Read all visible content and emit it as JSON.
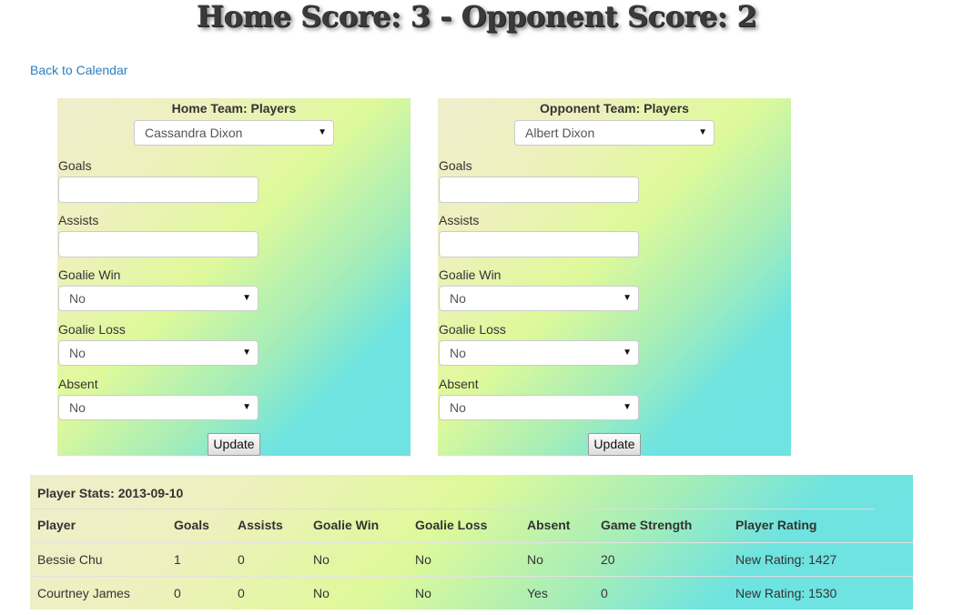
{
  "header": {
    "title": "Home Score: 3 - Opponent Score: 2"
  },
  "nav": {
    "back_link": "Back to Calendar"
  },
  "home": {
    "title": "Home Team: Players",
    "selected_player": "Cassandra Dixon",
    "goals_label": "Goals",
    "goals_value": "",
    "assists_label": "Assists",
    "assists_value": "",
    "goalie_win_label": "Goalie Win",
    "goalie_win_value": "No",
    "goalie_loss_label": "Goalie Loss",
    "goalie_loss_value": "No",
    "absent_label": "Absent",
    "absent_value": "No",
    "update_label": "Update"
  },
  "opponent": {
    "title": "Opponent Team: Players",
    "selected_player": "Albert Dixon",
    "goals_label": "Goals",
    "goals_value": "",
    "assists_label": "Assists",
    "assists_value": "",
    "goalie_win_label": "Goalie Win",
    "goalie_win_value": "No",
    "goalie_loss_label": "Goalie Loss",
    "goalie_loss_value": "No",
    "absent_label": "Absent",
    "absent_value": "No",
    "update_label": "Update"
  },
  "stats": {
    "caption": "Player Stats: 2013-09-10",
    "headers": [
      "Player",
      "Goals",
      "Assists",
      "Goalie Win",
      "Goalie Loss",
      "Absent",
      "Game Strength",
      "Player Rating"
    ],
    "rows": [
      [
        "Bessie Chu",
        "1",
        "0",
        "No",
        "No",
        "No",
        "20",
        "New Rating: 1427"
      ],
      [
        "Courtney James",
        "0",
        "0",
        "No",
        "No",
        "Yes",
        "0",
        "New Rating: 1530"
      ]
    ]
  }
}
